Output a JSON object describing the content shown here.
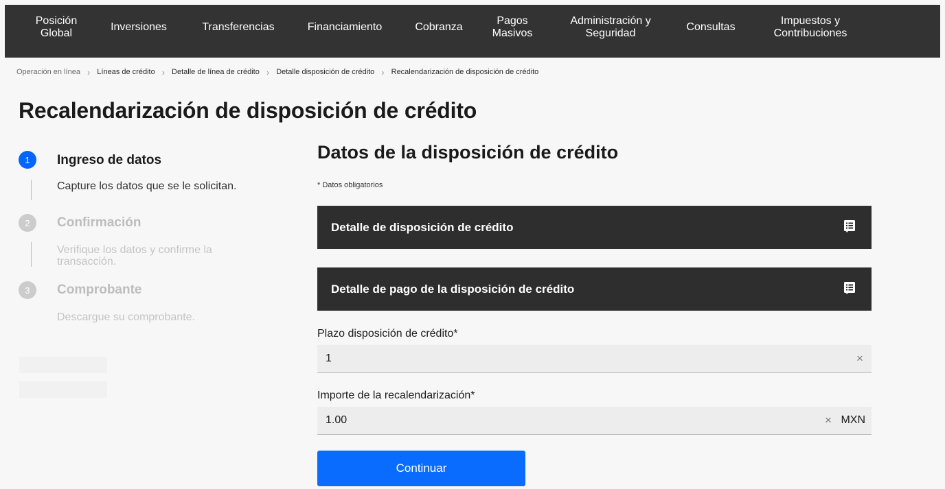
{
  "nav": {
    "items": [
      {
        "line1": "Posición",
        "line2": "Global"
      },
      {
        "line1": "Inversiones",
        "line2": ""
      },
      {
        "line1": "Transferencias",
        "line2": ""
      },
      {
        "line1": "Financiamiento",
        "line2": ""
      },
      {
        "line1": "Cobranza",
        "line2": ""
      },
      {
        "line1": "Pagos",
        "line2": "Masivos"
      },
      {
        "line1": "Administración y",
        "line2": "Seguridad"
      },
      {
        "line1": "Consultas",
        "line2": ""
      },
      {
        "line1": "Impuestos y",
        "line2": "Contribuciones"
      }
    ]
  },
  "breadcrumb": {
    "items": [
      "Operación en línea",
      "Líneas de crédito",
      "Detalle de línea de crédito",
      "Detalle disposición de crédito",
      "Recalendarización de disposición de crédito"
    ],
    "separator": "›"
  },
  "page_title": "Recalendarización de disposición de crédito",
  "stepper": {
    "steps": [
      {
        "number": "1",
        "title": "Ingreso de datos",
        "desc_line1": "Capture los datos que se le solicitan.",
        "desc_line2": "",
        "state": "active"
      },
      {
        "number": "2",
        "title": "Confirmación",
        "desc_line1": "Verifique los datos y confirme la",
        "desc_line2": "transacción.",
        "state": "inactive"
      },
      {
        "number": "3",
        "title": "Comprobante",
        "desc_line1": "Descargue su comprobante.",
        "desc_line2": "",
        "state": "inactive"
      }
    ]
  },
  "form": {
    "section_title": "Datos de la disposición de crédito",
    "required_note": "* Datos obligatorios",
    "accordions": [
      {
        "label": "Detalle de disposición de crédito",
        "icon": "list-icon"
      },
      {
        "label": "Detalle de pago de la disposición de crédito",
        "icon": "list-icon"
      }
    ],
    "plazo": {
      "label": "Plazo disposición de crédito*",
      "value": "1",
      "clear_glyph": "×"
    },
    "importe": {
      "label": "Importe de la recalendarización*",
      "value": "1.00",
      "clear_glyph": "×",
      "currency": "MXN"
    },
    "submit_label": "Continuar"
  },
  "colors": {
    "nav_bg": "#333333",
    "accent": "#0a6cff",
    "accordion_bg": "#2e2e2e",
    "field_bg": "#ededed"
  }
}
